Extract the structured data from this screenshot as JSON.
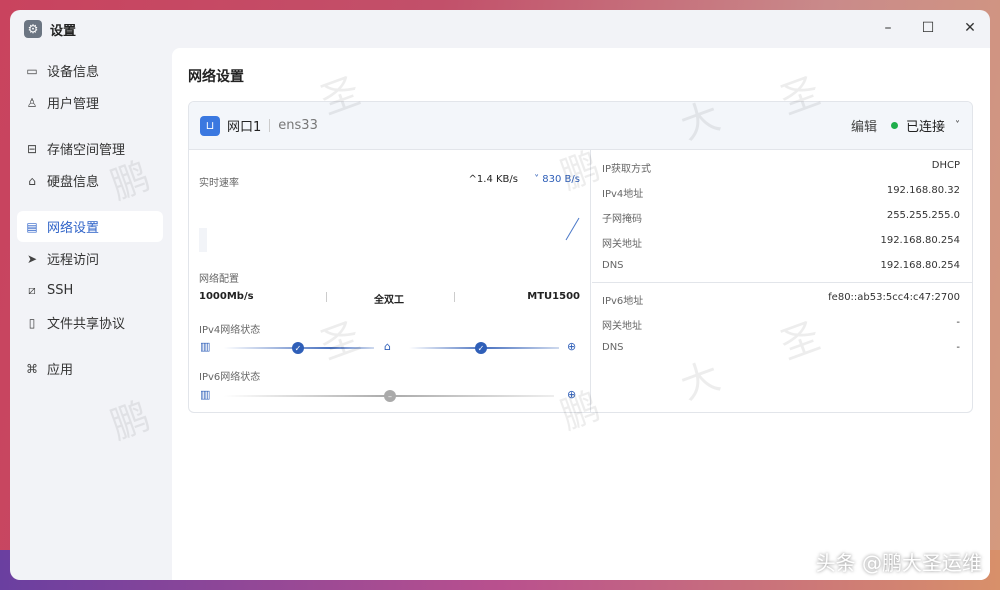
{
  "window": {
    "title": "设置",
    "minimize": "–",
    "maximize": "☐",
    "close": "✕"
  },
  "sidebar": {
    "items": [
      {
        "label": "设备信息",
        "icon": "▭"
      },
      {
        "label": "用户管理",
        "icon": "♙"
      },
      {
        "label": "存储空间管理",
        "icon": "⊟"
      },
      {
        "label": "硬盘信息",
        "icon": "⌂"
      },
      {
        "label": "网络设置",
        "icon": "▤"
      },
      {
        "label": "远程访问",
        "icon": "➤"
      },
      {
        "label": "SSH",
        "icon": "⧄"
      },
      {
        "label": "文件共享协议",
        "icon": "▯"
      },
      {
        "label": "应用",
        "icon": "⌘"
      }
    ]
  },
  "page": {
    "title": "网络设置"
  },
  "port": {
    "name": "网口1",
    "device": "ens33",
    "edit": "编辑",
    "status": "已连接",
    "status_color": "#1fae4b",
    "speed_label": "实时速率",
    "upload": "^1.4 KB/s",
    "download": "˅ 830 B/s",
    "config_label": "网络配置",
    "link_speed": "1000Mb/s",
    "duplex": "全双工",
    "mtu": "MTU1500",
    "ipv4_status_label": "IPv4网络状态",
    "ipv6_status_label": "IPv6网络状态"
  },
  "ipv4": [
    {
      "k": "IP获取方式",
      "v": "DHCP"
    },
    {
      "k": "IPv4地址",
      "v": "192.168.80.32"
    },
    {
      "k": "子网掩码",
      "v": "255.255.255.0"
    },
    {
      "k": "网关地址",
      "v": "192.168.80.254"
    },
    {
      "k": "DNS",
      "v": "192.168.80.254"
    }
  ],
  "ipv6": [
    {
      "k": "IPv6地址",
      "v": "fe80::ab53:5cc4:c47:2700"
    },
    {
      "k": "网关地址",
      "v": "-"
    },
    {
      "k": "DNS",
      "v": "-"
    }
  ],
  "watermark": {
    "credit": "头条 @鹏大圣运维",
    "chars": [
      "鹏",
      "大",
      "圣"
    ]
  }
}
